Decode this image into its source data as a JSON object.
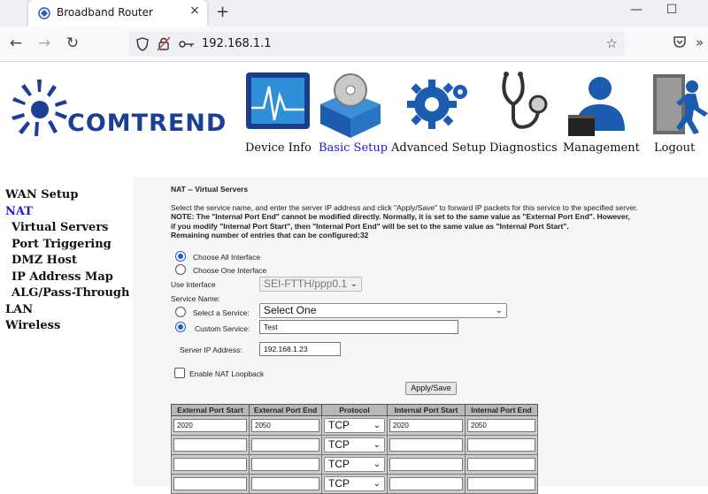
{
  "browser": {
    "tab_title": "Broadband Router",
    "tab_close": "×",
    "new_tab": "+",
    "url": "192.168.1.1",
    "minimize": "—",
    "maximize": "☐"
  },
  "brand": {
    "logo_text": "COMTREND",
    "color": "#1a3f95"
  },
  "top_nav": [
    {
      "label": "Device Info",
      "icon": "device-info-icon"
    },
    {
      "label": "Basic Setup",
      "icon": "basic-setup-icon",
      "active": true
    },
    {
      "label": "Advanced Setup",
      "icon": "advanced-setup-icon"
    },
    {
      "label": "Diagnostics",
      "icon": "diagnostics-icon"
    },
    {
      "label": "Management",
      "icon": "management-icon"
    },
    {
      "label": "Logout",
      "icon": "logout-icon"
    }
  ],
  "sidebar": {
    "items": [
      {
        "label": "WAN Setup"
      },
      {
        "label": "NAT",
        "active": true
      },
      {
        "label": "Virtual Servers",
        "sub": true
      },
      {
        "label": "Port Triggering",
        "sub": true
      },
      {
        "label": "DMZ Host",
        "sub": true
      },
      {
        "label": "IP Address Map",
        "sub": true
      },
      {
        "label": "ALG/Pass-Through",
        "sub": true
      },
      {
        "label": "LAN"
      },
      {
        "label": "Wireless"
      }
    ]
  },
  "page": {
    "title": "NAT -- Virtual Servers",
    "intro": "Select the service name, and enter the server IP address and click \"Apply/Save\" to forward IP packets for this service to the specified server.",
    "note1": "NOTE: The \"Internal Port End\" cannot be modified directly. Normally, it is set to the same value as \"External Port End\". However,",
    "note2": "if you modify \"Internal Port Start\", then \"Internal Port End\" will be set to the same value as \"Internal Port Start\".",
    "remaining": "Remaining number of entries that can be configured:32",
    "choose_all": "Choose All Interface",
    "choose_one": "Choose One Interface",
    "use_interface_label": "Use Interface",
    "use_interface_value": "SEI-FTTH/ppp0.1",
    "service_name_label": "Service Name:",
    "select_service_label": "Select a Service:",
    "select_service_value": "Select One",
    "custom_service_label": "Custom Service:",
    "custom_service_value": "Test",
    "server_ip_label": "Server IP Address:",
    "server_ip_value": "192.168.1.23",
    "nat_loopback_label": "Enable NAT Loopback",
    "apply_label": "Apply/Save"
  },
  "table": {
    "headers": [
      "External Port Start",
      "External Port End",
      "Protocol",
      "Internal Port Start",
      "Internal Port End"
    ],
    "rows": [
      [
        "2020",
        "2050",
        "TCP",
        "2020",
        "2050"
      ],
      [
        "",
        "",
        "TCP",
        "",
        ""
      ],
      [
        "",
        "",
        "TCP",
        "",
        ""
      ],
      [
        "",
        "",
        "TCP",
        "",
        ""
      ]
    ]
  }
}
